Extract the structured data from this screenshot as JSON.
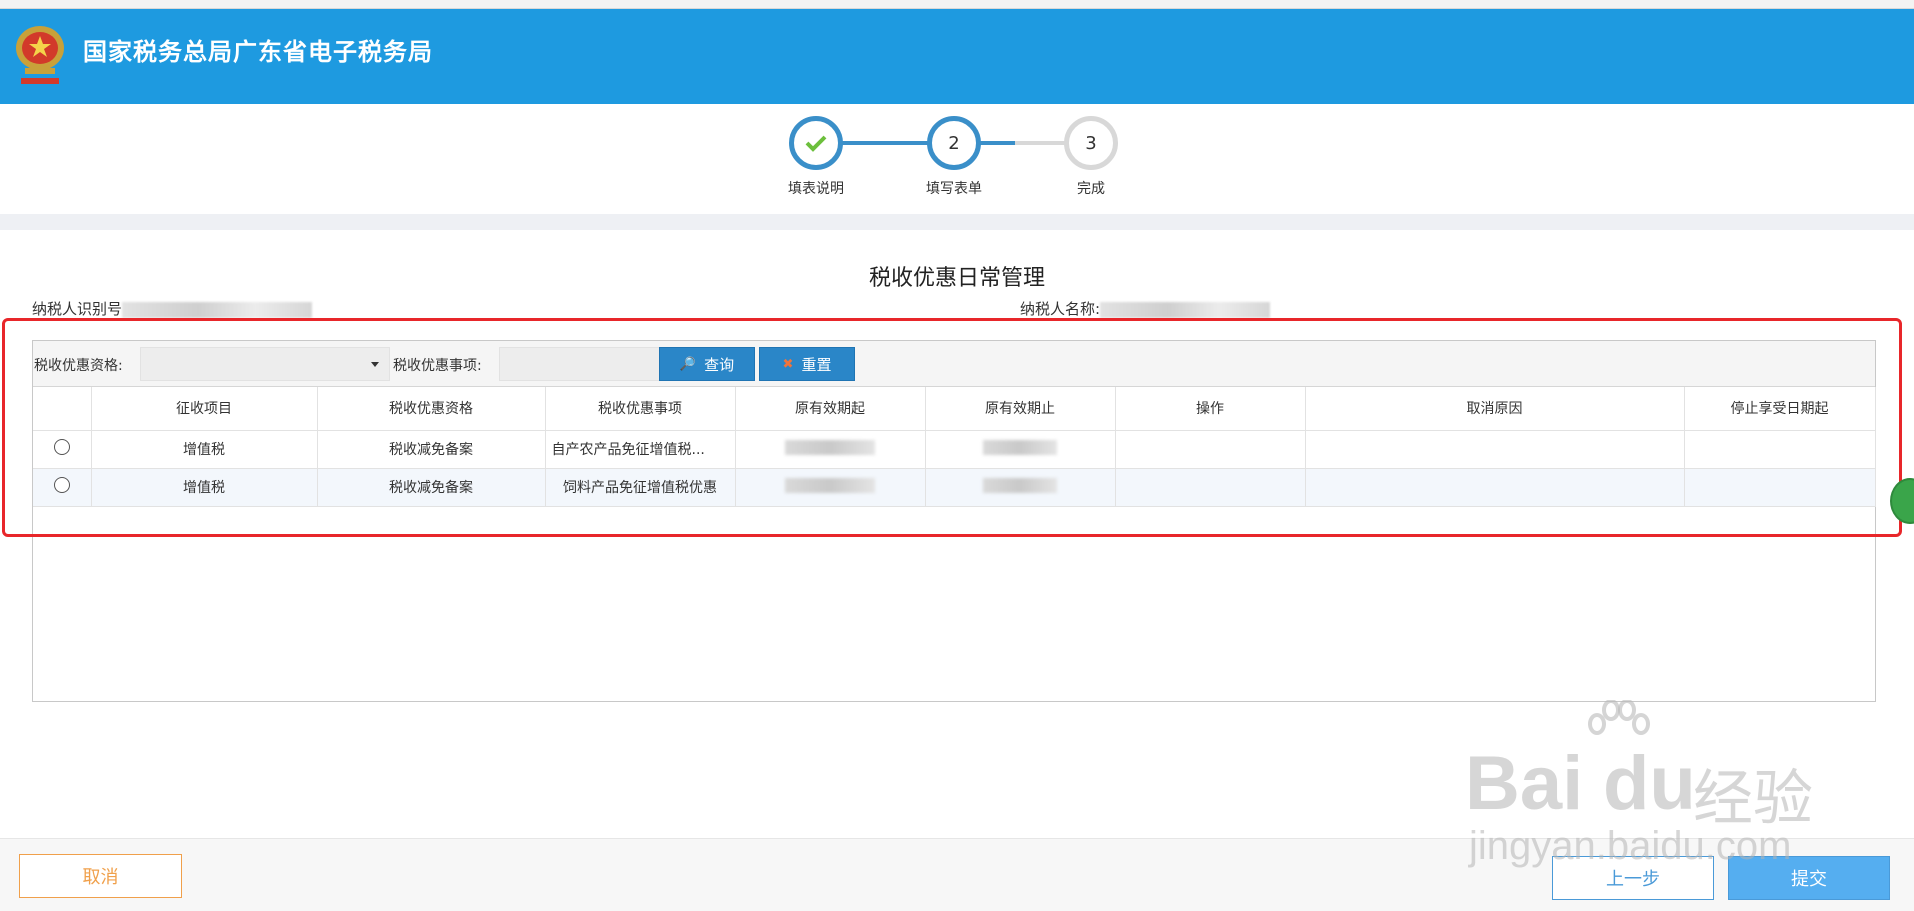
{
  "header": {
    "title": "国家税务总局广东省电子税务局"
  },
  "steps": [
    {
      "label": "填表说明",
      "state": "done"
    },
    {
      "label": "填写表单",
      "number": "2",
      "state": "active"
    },
    {
      "label": "完成",
      "number": "3",
      "state": "todo"
    }
  ],
  "form": {
    "title": "税收优惠日常管理",
    "taxpayer_id_label": "纳税人识别号",
    "taxpayer_name_label": "纳税人名称:"
  },
  "toolbar": {
    "qualification_label": "税收优惠资格:",
    "qualification_value": "",
    "item_label": "税收优惠事项:",
    "item_value": "",
    "query_label": "查询",
    "reset_label": "重置"
  },
  "table": {
    "columns": [
      "",
      "征收项目",
      "税收优惠资格",
      "税收优惠事项",
      "原有效期起",
      "原有效期止",
      "操作",
      "取消原因",
      "停止享受日期起"
    ],
    "rows": [
      {
        "levy_item": "增值税",
        "qualification": "税收减免备案",
        "item": "自产农产品免征增值税...",
        "start": "",
        "end": "",
        "op": "",
        "cancel_reason": "",
        "stop_date": ""
      },
      {
        "levy_item": "增值税",
        "qualification": "税收减免备案",
        "item": "饲料产品免征增值税优惠",
        "start": "",
        "end": "",
        "op": "",
        "cancel_reason": "",
        "stop_date": ""
      }
    ]
  },
  "footer": {
    "cancel_label": "取消",
    "prev_label": "上一步",
    "submit_label": "提交"
  },
  "watermark": {
    "brand": "Bai",
    "brand2": "du",
    "cn": "经验",
    "url": "jingyan.baidu.com"
  },
  "colors": {
    "header": "#1e9ae0",
    "accent": "#2a86c8",
    "step_done": "#3a8fc9",
    "cancel": "#f0a04b",
    "annotation": "#e8262a"
  }
}
